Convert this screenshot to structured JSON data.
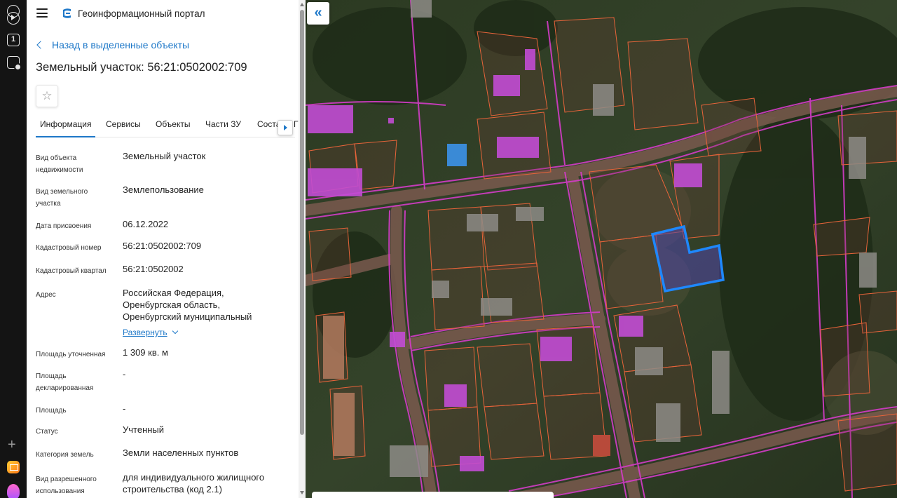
{
  "header": {
    "portal_title": "Геоинформационный портал"
  },
  "nav": {
    "back_label": "Назад в выделенные объекты"
  },
  "object": {
    "title": "Земельный участок: 56:21:0502002:709"
  },
  "tabs": [
    {
      "label": "Информация",
      "active": true
    },
    {
      "label": "Сервисы"
    },
    {
      "label": "Объекты"
    },
    {
      "label": "Части ЗУ"
    },
    {
      "label": "Соста"
    },
    {
      "label": "Г"
    }
  ],
  "info": {
    "object_type": {
      "label": "Вид объекта недвижимости",
      "value": "Земельный участок"
    },
    "parcel_type": {
      "label": "Вид земельного участка",
      "value": "Землепользование"
    },
    "assign_date": {
      "label": "Дата присвоения",
      "value": "06.12.2022"
    },
    "cad_number": {
      "label": "Кадастровый номер",
      "value": "56:21:0502002:709"
    },
    "cad_quarter": {
      "label": "Кадастровый квартал",
      "value": "56:21:0502002"
    },
    "address": {
      "label": "Адрес",
      "line1": "Российская Федерация,",
      "line2": "Оренбургская область,",
      "line3": "Оренбургский муниципальный",
      "expand_label": "Развернуть"
    },
    "area_refined": {
      "label": "Площадь уточненная",
      "value": "1 309 кв. м"
    },
    "area_declared": {
      "label": "Площадь декларированная",
      "value": "-"
    },
    "area": {
      "label": "Площадь",
      "value": "-"
    },
    "status": {
      "label": "Статус",
      "value": "Учтенный"
    },
    "land_category": {
      "label": "Категория земель",
      "value": "Земли населенных пунктов"
    },
    "permitted_use": {
      "label": "Вид разрешенного использования",
      "value": "для индивидуального жилищного строительства (код 2.1)"
    }
  },
  "map": {
    "collapse_icon": "double-chevron-left-icon",
    "highlight_color": "#1e88ff",
    "parcel_border_color": "#e8643a",
    "boundary_color": "#d43cc8",
    "building_color": "#c24cd4"
  }
}
